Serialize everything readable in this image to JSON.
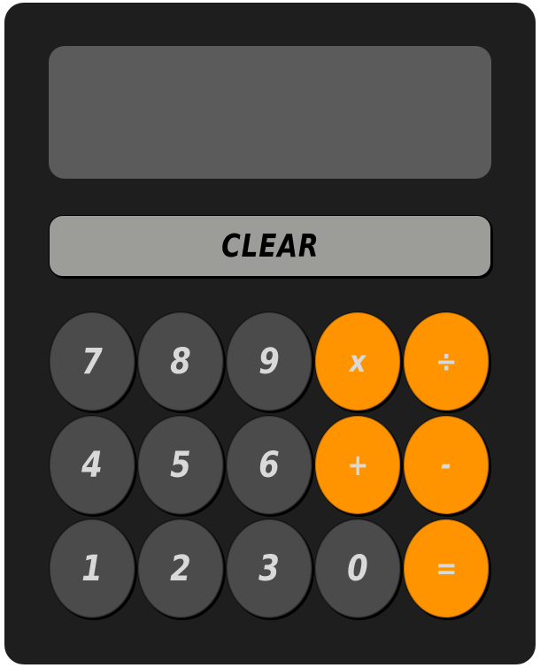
{
  "display": {
    "value": ""
  },
  "clear": {
    "label": "CLEAR"
  },
  "colors": {
    "body": "#1e1e1e",
    "display": "#5b5b5b",
    "clear": "#9c9c98",
    "number_key": "#4b4b4b",
    "operator_key": "#ff9300",
    "key_text": "#d9d9d9"
  },
  "keys": {
    "k7": "7",
    "k8": "8",
    "k9": "9",
    "multiply": "x",
    "divide": "÷",
    "k4": "4",
    "k5": "5",
    "k6": "6",
    "add": "+",
    "subtract": "-",
    "k1": "1",
    "k2": "2",
    "k3": "3",
    "k0": "0",
    "equals": "="
  }
}
